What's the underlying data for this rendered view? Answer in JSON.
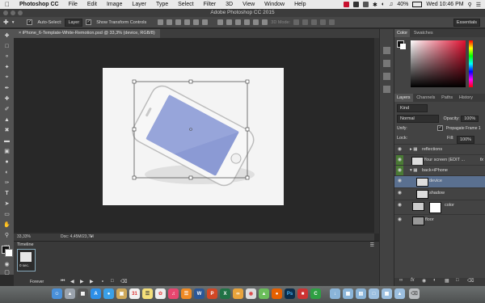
{
  "menubar": {
    "apple_icon": "apple-icon",
    "app_name": "Photoshop CC",
    "items": [
      "File",
      "Edit",
      "Image",
      "Layer",
      "Type",
      "Select",
      "Filter",
      "3D",
      "View",
      "Window",
      "Help"
    ],
    "battery": "40%",
    "clock": "Wed 10:46 PM"
  },
  "window": {
    "title": "Adobe Photoshop CC 2015"
  },
  "options": {
    "auto_select_label": "Auto-Select:",
    "auto_select_value": "Layer",
    "show_transform_label": "Show Transform Controls",
    "mode_3d": "3D Mode:",
    "workspace": "Essentials"
  },
  "document": {
    "tab_title": "iPhone_6-Template-White-Remotion.psd @ 33,3% (device, RGB/8)",
    "zoom": "33,33%",
    "doc_info": "Doc: 4,45M/23,7M"
  },
  "timeline": {
    "title": "Timeline",
    "frame_time": "0 sec.",
    "loop": "Forever"
  },
  "color_panel": {
    "tabs": [
      "Color",
      "Swatches"
    ],
    "accent": "#c8102e"
  },
  "layers_panel": {
    "tabs": [
      "Layers",
      "Channels",
      "Paths",
      "History"
    ],
    "kind_label": "Kind",
    "blend_mode": "Normal",
    "opacity_label": "Opacity:",
    "opacity_value": "100%",
    "unify_label": "Unify:",
    "propagate_label": "Propagate Frame 1",
    "lock_label": "Lock:",
    "fill_label": "Fill:",
    "fill_value": "100%",
    "layers": [
      {
        "name": "reflections",
        "type": "group"
      },
      {
        "name": "Your screen (EDIT ...",
        "type": "smart"
      },
      {
        "name": "back+iPhone",
        "type": "group"
      },
      {
        "name": "device",
        "type": "layer",
        "selected": true
      },
      {
        "name": "shadow",
        "type": "layer"
      },
      {
        "name": "color",
        "type": "fill"
      },
      {
        "name": "floor",
        "type": "layer"
      }
    ]
  }
}
